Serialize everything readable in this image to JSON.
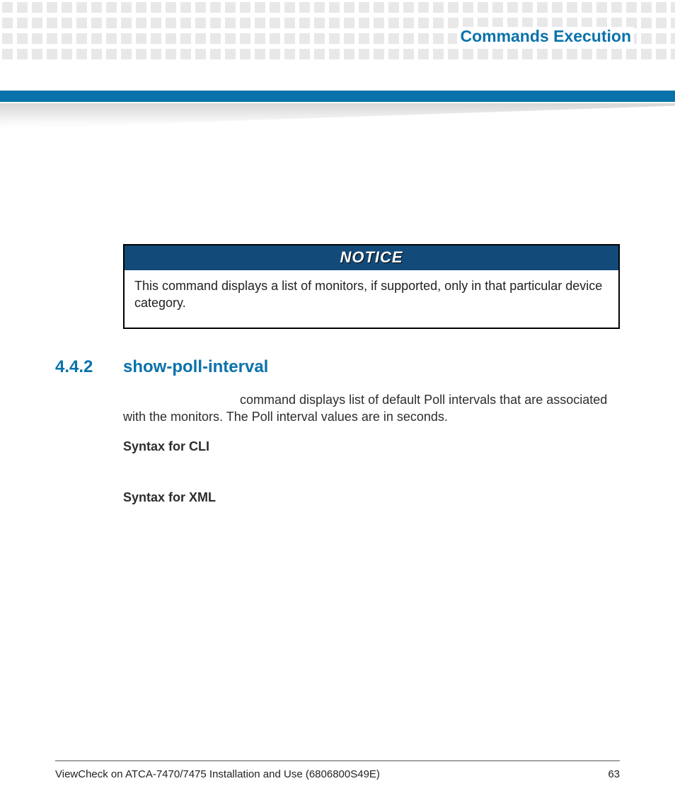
{
  "header": {
    "chapter_title": "Commands Execution"
  },
  "notice": {
    "label": "NOTICE",
    "body": "This command displays a list of monitors, if supported, only in that particular device category."
  },
  "section": {
    "number": "4.4.2",
    "title": "show-poll-interval",
    "paragraph_tail": "command displays list of default Poll intervals that are associated with the monitors. The Poll interval values are in seconds.",
    "syntax_cli_label": "Syntax for CLI",
    "syntax_xml_label": "Syntax for XML"
  },
  "footer": {
    "doc_title": "ViewCheck on ATCA-7470/7475 Installation and Use (6806800S49E)",
    "page_number": "63"
  }
}
